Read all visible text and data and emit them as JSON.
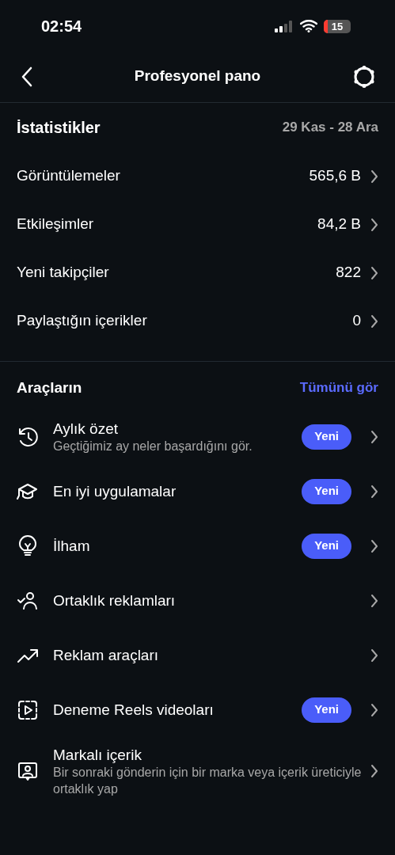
{
  "status_bar": {
    "time": "02:54",
    "battery": "15"
  },
  "header": {
    "title": "Profesyonel pano"
  },
  "stats": {
    "title": "İstatistikler",
    "range": "29 Kas - 28 Ara",
    "rows": [
      {
        "label": "Görüntülemeler",
        "value": "565,6 B"
      },
      {
        "label": "Etkileşimler",
        "value": "84,2 B"
      },
      {
        "label": "Yeni takipçiler",
        "value": "822"
      },
      {
        "label": "Paylaştığın içerikler",
        "value": "0"
      }
    ]
  },
  "tools": {
    "title": "Araçların",
    "link": "Tümünü gör",
    "items": [
      {
        "label": "Aylık özet",
        "subtitle": "Geçtiğimiz ay neler başardığını gör.",
        "badge": "Yeni"
      },
      {
        "label": "En iyi uygulamalar",
        "badge": "Yeni"
      },
      {
        "label": "İlham",
        "badge": "Yeni"
      },
      {
        "label": "Ortaklık reklamları"
      },
      {
        "label": "Reklam araçları"
      },
      {
        "label": "Deneme Reels videoları",
        "badge": "Yeni"
      },
      {
        "label": "Markalı içerik",
        "subtitle": "Bir sonraki gönderin için bir marka veya içerik üreticiyle ortaklık yap"
      }
    ]
  }
}
